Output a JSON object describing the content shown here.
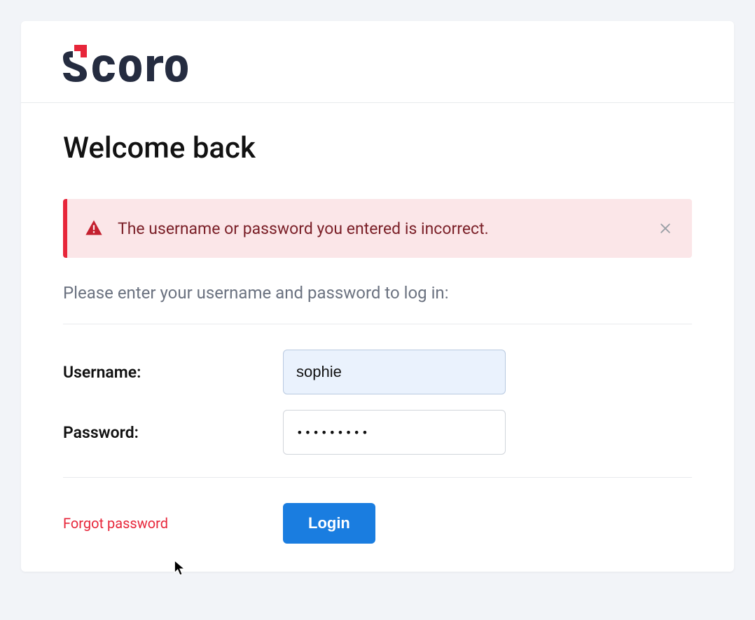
{
  "brand": {
    "name": "Scoro",
    "logo_text_color": "#252c40",
    "logo_accent_color": "#e7263a"
  },
  "title": "Welcome back",
  "alert": {
    "message": "The username or password you entered is incorrect.",
    "type": "error"
  },
  "instruction": "Please enter your username and password to log in:",
  "form": {
    "username_label": "Username:",
    "username_value": "sophie",
    "password_label": "Password:",
    "password_value": "•••••••••"
  },
  "actions": {
    "forgot_password": "Forgot password",
    "login_button": "Login"
  },
  "colors": {
    "error_bg": "#fbe6e8",
    "error_border": "#e7263a",
    "error_text": "#7a1f27",
    "primary_button": "#1a7de0"
  }
}
